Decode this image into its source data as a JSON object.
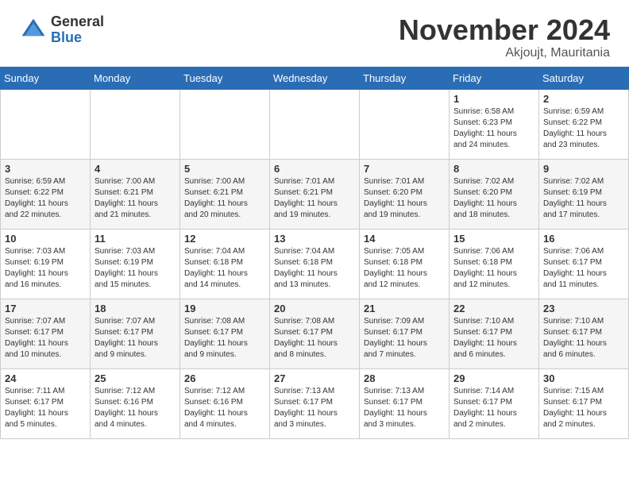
{
  "logo": {
    "general": "General",
    "blue": "Blue"
  },
  "title": "November 2024",
  "location": "Akjoujt, Mauritania",
  "weekdays": [
    "Sunday",
    "Monday",
    "Tuesday",
    "Wednesday",
    "Thursday",
    "Friday",
    "Saturday"
  ],
  "weeks": [
    [
      {
        "day": "",
        "info": ""
      },
      {
        "day": "",
        "info": ""
      },
      {
        "day": "",
        "info": ""
      },
      {
        "day": "",
        "info": ""
      },
      {
        "day": "",
        "info": ""
      },
      {
        "day": "1",
        "info": "Sunrise: 6:58 AM\nSunset: 6:23 PM\nDaylight: 11 hours\nand 24 minutes."
      },
      {
        "day": "2",
        "info": "Sunrise: 6:59 AM\nSunset: 6:22 PM\nDaylight: 11 hours\nand 23 minutes."
      }
    ],
    [
      {
        "day": "3",
        "info": "Sunrise: 6:59 AM\nSunset: 6:22 PM\nDaylight: 11 hours\nand 22 minutes."
      },
      {
        "day": "4",
        "info": "Sunrise: 7:00 AM\nSunset: 6:21 PM\nDaylight: 11 hours\nand 21 minutes."
      },
      {
        "day": "5",
        "info": "Sunrise: 7:00 AM\nSunset: 6:21 PM\nDaylight: 11 hours\nand 20 minutes."
      },
      {
        "day": "6",
        "info": "Sunrise: 7:01 AM\nSunset: 6:21 PM\nDaylight: 11 hours\nand 19 minutes."
      },
      {
        "day": "7",
        "info": "Sunrise: 7:01 AM\nSunset: 6:20 PM\nDaylight: 11 hours\nand 19 minutes."
      },
      {
        "day": "8",
        "info": "Sunrise: 7:02 AM\nSunset: 6:20 PM\nDaylight: 11 hours\nand 18 minutes."
      },
      {
        "day": "9",
        "info": "Sunrise: 7:02 AM\nSunset: 6:19 PM\nDaylight: 11 hours\nand 17 minutes."
      }
    ],
    [
      {
        "day": "10",
        "info": "Sunrise: 7:03 AM\nSunset: 6:19 PM\nDaylight: 11 hours\nand 16 minutes."
      },
      {
        "day": "11",
        "info": "Sunrise: 7:03 AM\nSunset: 6:19 PM\nDaylight: 11 hours\nand 15 minutes."
      },
      {
        "day": "12",
        "info": "Sunrise: 7:04 AM\nSunset: 6:18 PM\nDaylight: 11 hours\nand 14 minutes."
      },
      {
        "day": "13",
        "info": "Sunrise: 7:04 AM\nSunset: 6:18 PM\nDaylight: 11 hours\nand 13 minutes."
      },
      {
        "day": "14",
        "info": "Sunrise: 7:05 AM\nSunset: 6:18 PM\nDaylight: 11 hours\nand 12 minutes."
      },
      {
        "day": "15",
        "info": "Sunrise: 7:06 AM\nSunset: 6:18 PM\nDaylight: 11 hours\nand 12 minutes."
      },
      {
        "day": "16",
        "info": "Sunrise: 7:06 AM\nSunset: 6:17 PM\nDaylight: 11 hours\nand 11 minutes."
      }
    ],
    [
      {
        "day": "17",
        "info": "Sunrise: 7:07 AM\nSunset: 6:17 PM\nDaylight: 11 hours\nand 10 minutes."
      },
      {
        "day": "18",
        "info": "Sunrise: 7:07 AM\nSunset: 6:17 PM\nDaylight: 11 hours\nand 9 minutes."
      },
      {
        "day": "19",
        "info": "Sunrise: 7:08 AM\nSunset: 6:17 PM\nDaylight: 11 hours\nand 9 minutes."
      },
      {
        "day": "20",
        "info": "Sunrise: 7:08 AM\nSunset: 6:17 PM\nDaylight: 11 hours\nand 8 minutes."
      },
      {
        "day": "21",
        "info": "Sunrise: 7:09 AM\nSunset: 6:17 PM\nDaylight: 11 hours\nand 7 minutes."
      },
      {
        "day": "22",
        "info": "Sunrise: 7:10 AM\nSunset: 6:17 PM\nDaylight: 11 hours\nand 6 minutes."
      },
      {
        "day": "23",
        "info": "Sunrise: 7:10 AM\nSunset: 6:17 PM\nDaylight: 11 hours\nand 6 minutes."
      }
    ],
    [
      {
        "day": "24",
        "info": "Sunrise: 7:11 AM\nSunset: 6:17 PM\nDaylight: 11 hours\nand 5 minutes."
      },
      {
        "day": "25",
        "info": "Sunrise: 7:12 AM\nSunset: 6:16 PM\nDaylight: 11 hours\nand 4 minutes."
      },
      {
        "day": "26",
        "info": "Sunrise: 7:12 AM\nSunset: 6:16 PM\nDaylight: 11 hours\nand 4 minutes."
      },
      {
        "day": "27",
        "info": "Sunrise: 7:13 AM\nSunset: 6:17 PM\nDaylight: 11 hours\nand 3 minutes."
      },
      {
        "day": "28",
        "info": "Sunrise: 7:13 AM\nSunset: 6:17 PM\nDaylight: 11 hours\nand 3 minutes."
      },
      {
        "day": "29",
        "info": "Sunrise: 7:14 AM\nSunset: 6:17 PM\nDaylight: 11 hours\nand 2 minutes."
      },
      {
        "day": "30",
        "info": "Sunrise: 7:15 AM\nSunset: 6:17 PM\nDaylight: 11 hours\nand 2 minutes."
      }
    ]
  ]
}
